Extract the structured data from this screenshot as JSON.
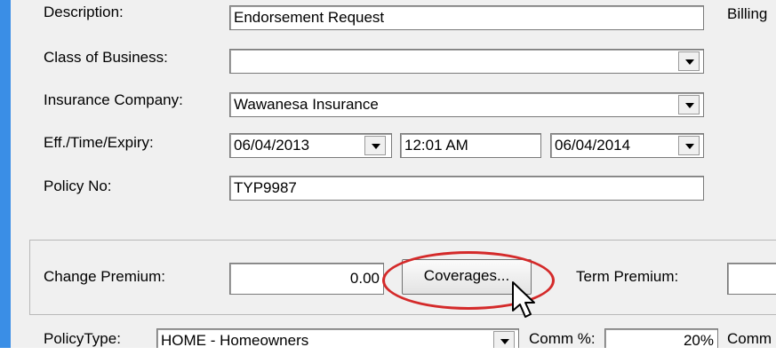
{
  "form": {
    "description": {
      "label": "Description:",
      "value": "Endorsement Request"
    },
    "billing_label": "Billing",
    "class_of_business": {
      "label": "Class of Business:",
      "value": ""
    },
    "insurance_company": {
      "label": "Insurance Company:",
      "value": "Wawanesa Insurance"
    },
    "eff_time_expiry": {
      "label": "Eff./Time/Expiry:",
      "effective": "06/04/2013",
      "time": "12:01 AM",
      "expiry": "06/04/2014"
    },
    "policy_no": {
      "label": "Policy No:",
      "value": "TYP9987"
    }
  },
  "premium": {
    "change_premium_label": "Change Premium:",
    "change_premium_value": "0.00",
    "coverages_button": "Coverages...",
    "term_premium_label": "Term Premium:",
    "term_premium_value": ""
  },
  "bottom_row": {
    "policy_type_label": "PolicyType:",
    "policy_type_value": "HOME - Homeowners",
    "comm_pct_label": "Comm %:",
    "comm_pct_value": "20%",
    "comm_label": "Comm"
  },
  "colors": {
    "highlight_oval": "#d42a2a",
    "accent_bar": "#3a8ee6"
  }
}
